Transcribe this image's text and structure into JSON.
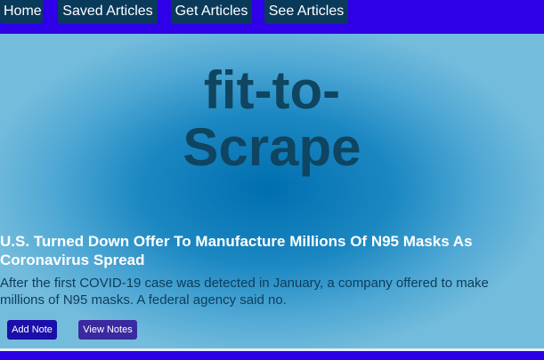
{
  "nav": {
    "items": [
      {
        "label": "Home"
      },
      {
        "label": "Saved Articles"
      },
      {
        "label": "Get Articles"
      },
      {
        "label": "See Articles"
      }
    ]
  },
  "hero": {
    "title_line1": "fit-to-",
    "title_line2": "Scrape"
  },
  "article": {
    "title": "U.S. Turned Down Offer To Manufacture Millions Of N95 Masks As Coronavirus Spread",
    "summary": "After the first COVID-19 case was detected in January, a company offered to make millions of N95 masks. A federal agency said no.",
    "add_note_label": "Add Note",
    "view_notes_label": "View Notes"
  },
  "colors": {
    "navbar": "#2e00e8",
    "nav_button": "#0a3a5a",
    "hero_center": "#006fb0",
    "title_text": "#0f4560",
    "article_title": "#ffffff"
  }
}
